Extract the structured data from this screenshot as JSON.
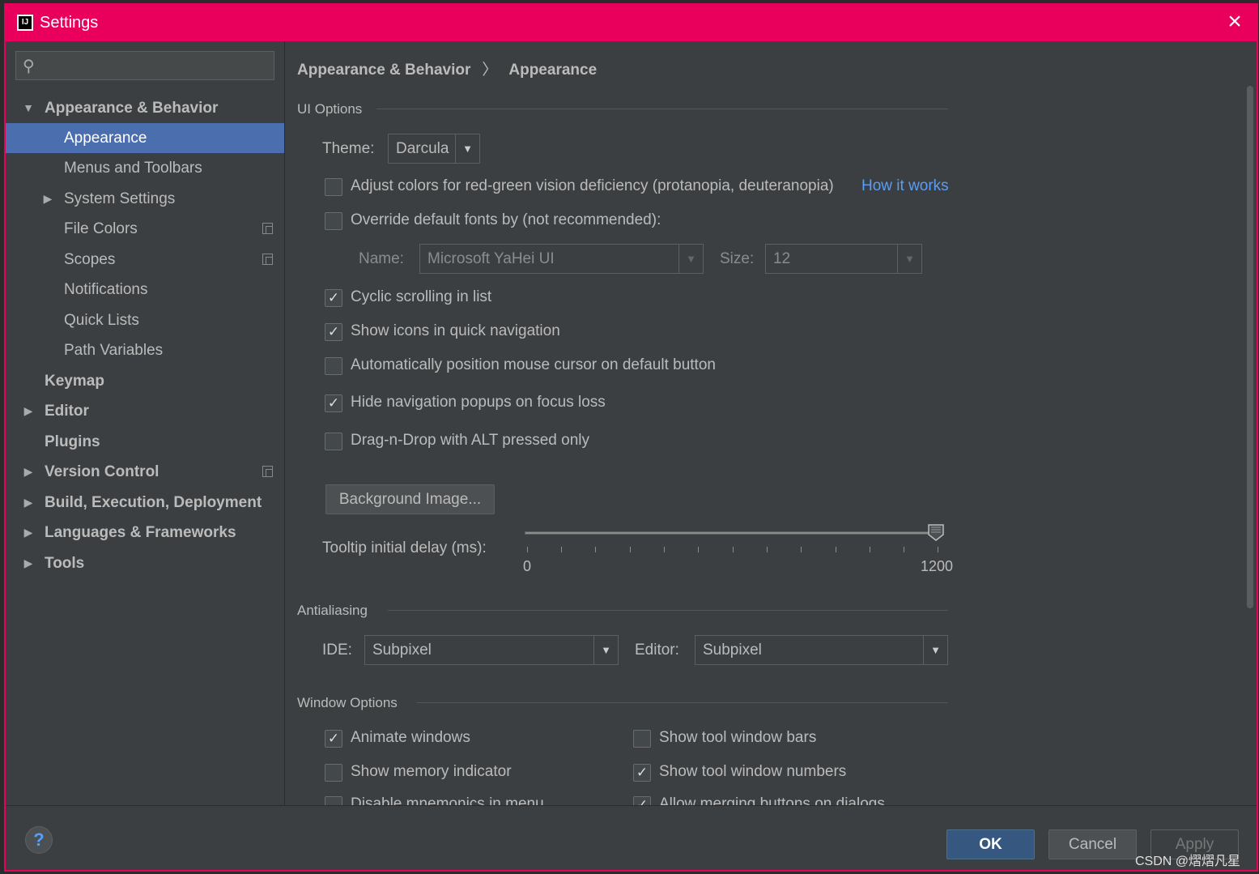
{
  "window": {
    "title": "Settings"
  },
  "search": {
    "placeholder": ""
  },
  "sidebar": {
    "items": [
      {
        "label": "Appearance & Behavior"
      },
      {
        "label": "Appearance"
      },
      {
        "label": "Menus and Toolbars"
      },
      {
        "label": "System Settings"
      },
      {
        "label": "File Colors"
      },
      {
        "label": "Scopes"
      },
      {
        "label": "Notifications"
      },
      {
        "label": "Quick Lists"
      },
      {
        "label": "Path Variables"
      },
      {
        "label": "Keymap"
      },
      {
        "label": "Editor"
      },
      {
        "label": "Plugins"
      },
      {
        "label": "Version Control"
      },
      {
        "label": "Build, Execution, Deployment"
      },
      {
        "label": "Languages & Frameworks"
      },
      {
        "label": "Tools"
      }
    ]
  },
  "breadcrumb": {
    "parent": "Appearance & Behavior",
    "separator": "〉",
    "current": "Appearance"
  },
  "ui_options": {
    "title": "UI Options",
    "theme_label": "Theme:",
    "theme_value": "Darcula",
    "adjust_colors": "Adjust colors for red-green vision deficiency (protanopia, deuteranopia)",
    "how_it_works": "How it works",
    "override_fonts": "Override default fonts by (not recommended):",
    "name_label": "Name:",
    "name_value": "Microsoft YaHei UI",
    "size_label": "Size:",
    "size_value": "12",
    "cyclic_scrolling": "Cyclic scrolling in list",
    "show_icons": "Show icons in quick navigation",
    "auto_position": "Automatically position mouse cursor on default button",
    "hide_popups": "Hide navigation popups on focus loss",
    "drag_drop": "Drag-n-Drop with ALT pressed only",
    "background_image": "Background Image...",
    "tooltip_label": "Tooltip initial delay (ms):",
    "tooltip_min": "0",
    "tooltip_max": "1200"
  },
  "antialiasing": {
    "title": "Antialiasing",
    "ide_label": "IDE:",
    "ide_value": "Subpixel",
    "editor_label": "Editor:",
    "editor_value": "Subpixel"
  },
  "window_options": {
    "title": "Window Options",
    "animate_windows": "Animate windows",
    "show_memory": "Show memory indicator",
    "disable_mnemonics": "Disable mnemonics in menu",
    "show_tool_bars": "Show tool window bars",
    "show_tool_numbers": "Show tool window numbers",
    "allow_merging": "Allow merging buttons on dialogs"
  },
  "footer": {
    "help": "?",
    "ok": "OK",
    "cancel": "Cancel",
    "apply": "Apply"
  },
  "watermark": "CSDN @熠熠凡星",
  "colors": {
    "titlebar": "#e8005c",
    "selection": "#4b6eaf",
    "link": "#589df6",
    "ok_button": "#365880"
  }
}
